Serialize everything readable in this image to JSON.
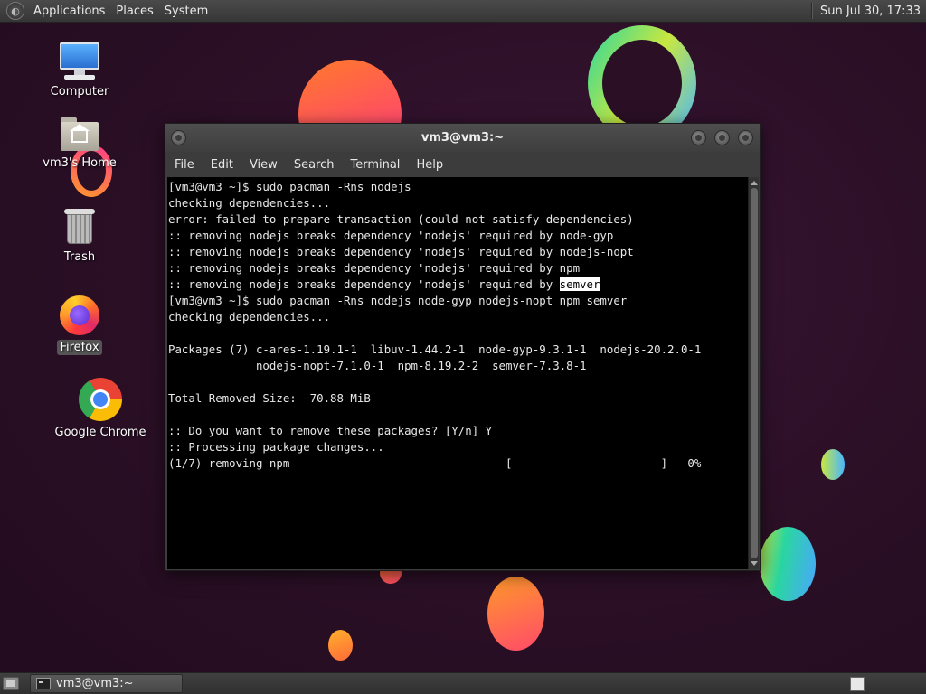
{
  "top_panel": {
    "menus": [
      "Applications",
      "Places",
      "System"
    ],
    "clock": "Sun Jul 30, 17:33"
  },
  "desktop_icons": [
    {
      "label": "Computer",
      "icon": "computer-icon"
    },
    {
      "label": "vm3's Home",
      "icon": "home-folder-icon"
    },
    {
      "label": "Trash",
      "icon": "trash-icon"
    },
    {
      "label": "Firefox",
      "icon": "firefox-icon",
      "selected": true
    },
    {
      "label": "Google Chrome",
      "icon": "chrome-icon"
    }
  ],
  "terminal": {
    "title": "vm3@vm3:~",
    "menu": [
      "File",
      "Edit",
      "View",
      "Search",
      "Terminal",
      "Help"
    ],
    "lines": [
      "[vm3@vm3 ~]$ sudo pacman -Rns nodejs",
      "checking dependencies...",
      "error: failed to prepare transaction (could not satisfy dependencies)",
      ":: removing nodejs breaks dependency 'nodejs' required by node-gyp",
      ":: removing nodejs breaks dependency 'nodejs' required by nodejs-nopt",
      ":: removing nodejs breaks dependency 'nodejs' required by npm",
      ":: removing nodejs breaks dependency 'nodejs' required by ",
      "[vm3@vm3 ~]$ sudo pacman -Rns nodejs node-gyp nodejs-nopt npm semver",
      "checking dependencies...",
      "",
      "Packages (7) c-ares-1.19.1-1  libuv-1.44.2-1  node-gyp-9.3.1-1  nodejs-20.2.0-1",
      "             nodejs-nopt-7.1.0-1  npm-8.19.2-2  semver-7.3.8-1",
      "",
      "Total Removed Size:  70.88 MiB",
      "",
      ":: Do you want to remove these packages? [Y/n] Y",
      ":: Processing package changes...",
      "(1/7) removing npm                                [----------------------]   0%"
    ],
    "highlighted_word": "semver"
  },
  "taskbar": {
    "task_label": "vm3@vm3:~"
  }
}
